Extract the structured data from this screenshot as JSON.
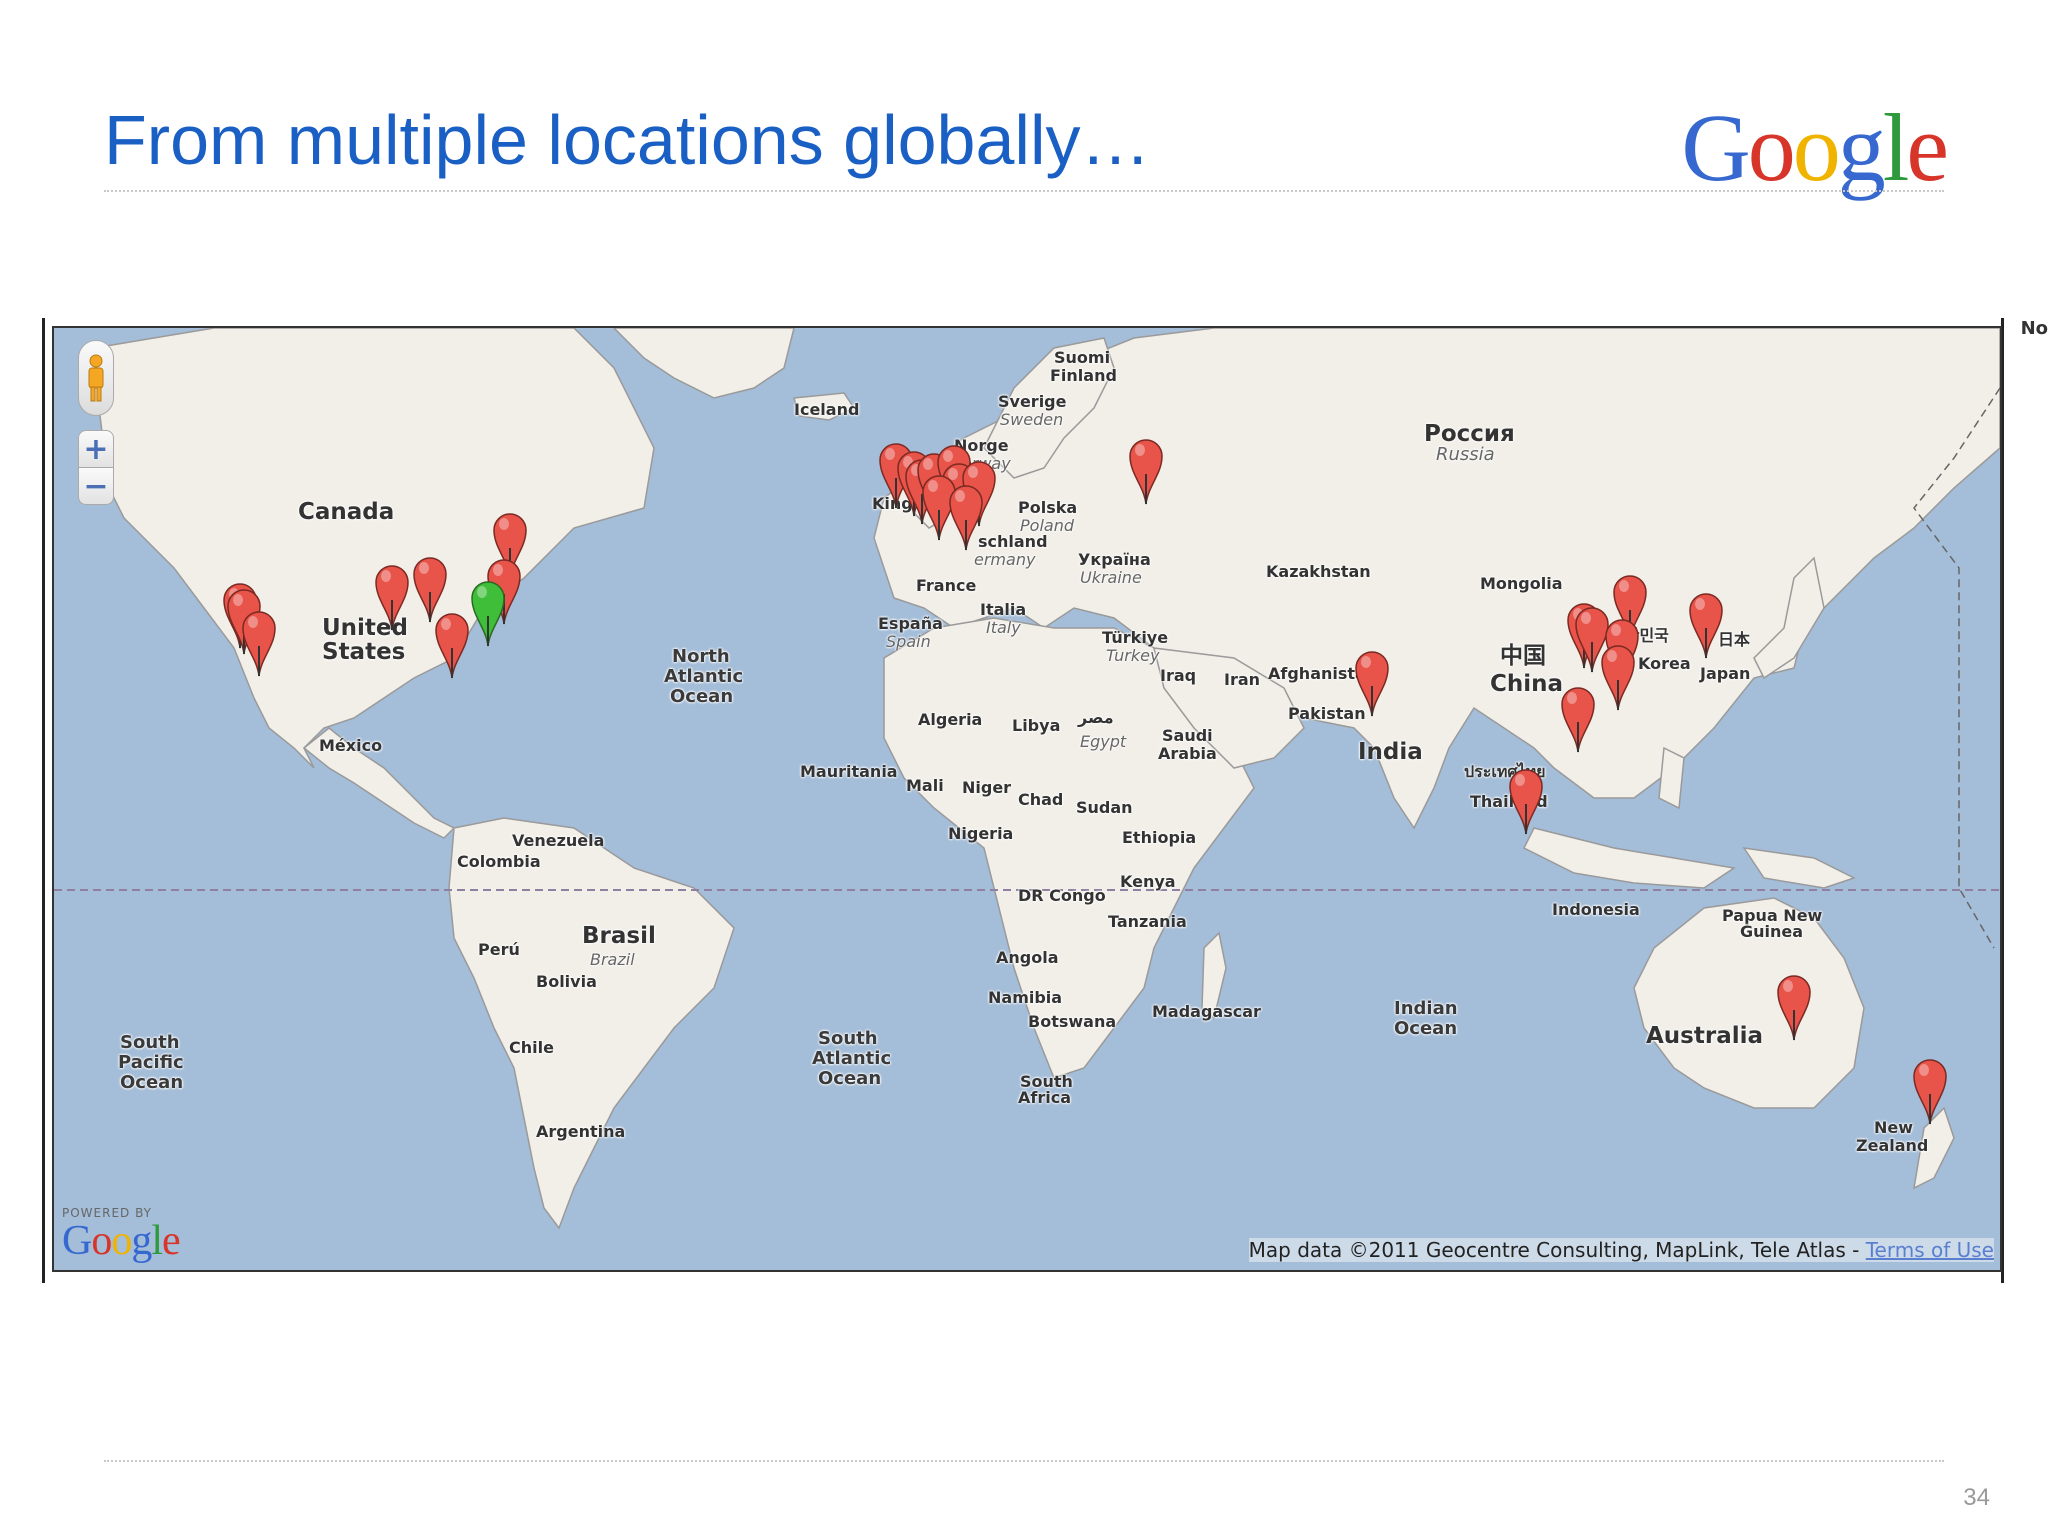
{
  "slide": {
    "title": "From multiple locations globally…",
    "page_number": "34",
    "logo_letters": [
      {
        "ch": "G",
        "color": "#3668cf"
      },
      {
        "ch": "o",
        "color": "#d8352a"
      },
      {
        "ch": "o",
        "color": "#f0b400"
      },
      {
        "ch": "g",
        "color": "#3668cf"
      },
      {
        "ch": "l",
        "color": "#2f9a3d"
      },
      {
        "ch": "e",
        "color": "#d8352a"
      }
    ]
  },
  "map": {
    "colors": {
      "water": "#a4bdd8",
      "land": "#f2efe9",
      "pin_red": "#e8534a",
      "pin_green": "#3fbe3a"
    },
    "controls": {
      "pegman_icon": "pegman-icon",
      "zoom_in_label": "+",
      "zoom_out_label": "−"
    },
    "powered_by": "POWERED BY",
    "powered_logo": "Google",
    "attribution": "Map data ©2011 Geocentre Consulting, MapLink, Tele Atlas - ",
    "terms_label": "Terms of Use",
    "cut_label": "No",
    "labels": {
      "canada": "Canada",
      "us1": "United",
      "us2": "States",
      "mexico": "México",
      "venezuela": "Venezuela",
      "colombia": "Colombia",
      "peru": "Perú",
      "brasil": "Brasil",
      "brazil": "Brazil",
      "bolivia": "Bolivia",
      "chile": "Chile",
      "argentina": "Argentina",
      "iceland": "Iceland",
      "suomi": "Suomi",
      "finland": "Finland",
      "sverige": "Sverige",
      "sweden": "Sweden",
      "norge": "Norge",
      "norway": "Norway",
      "polska": "Polska",
      "poland": "Poland",
      "deutschland": "schland",
      "germany": "ermany",
      "ukraina": "Україна",
      "ukraine": "Ukraine",
      "france": "France",
      "espana": "España",
      "spain": "Spain",
      "italia": "Italia",
      "italy": "Italy",
      "turkiye": "Türkiye",
      "turkey": "Turkey",
      "uk": "King",
      "russia_native": "Россия",
      "russia": "Russia",
      "kazakhstan": "Kazakhstan",
      "mongolia": "Mongolia",
      "china_native": "中国",
      "china": "China",
      "korea_native": "대한민국",
      "korea": "Korea",
      "japan_native": "日本",
      "japan": "Japan",
      "iraq": "Iraq",
      "iran": "Iran",
      "afghanistan": "Afghanista",
      "pakistan": "Pakistan",
      "india": "India",
      "thailand_native": "ประเทศไทย",
      "thailand": "Thailand",
      "indonesia": "Indonesia",
      "png1": "Papua New",
      "png2": "Guinea",
      "australia": "Australia",
      "nz1": "New",
      "nz2": "Zealand",
      "algeria": "Algeria",
      "libya": "Libya",
      "egypt_native": "مصر",
      "egypt": "Egypt",
      "saudi1": "Saudi",
      "saudi2": "Arabia",
      "mauritania": "Mauritania",
      "mali": "Mali",
      "niger": "Niger",
      "chad": "Chad",
      "sudan": "Sudan",
      "nigeria": "Nigeria",
      "ethiopia": "Ethiopia",
      "kenya": "Kenya",
      "drcongo": "DR Congo",
      "tanzania": "Tanzania",
      "angola": "Angola",
      "namibia": "Namibia",
      "botswana": "Botswana",
      "madagascar": "Madagascar",
      "sa1": "South",
      "sa2": "Africa",
      "nao1": "North",
      "nao2": "Atlantic",
      "nao3": "Ocean",
      "sao1": "South",
      "sao2": "Atlantic",
      "sao3": "Ocean",
      "spo1": "South",
      "spo2": "Pacific",
      "spo3": "Ocean",
      "io1": "Indian",
      "io2": "Ocean"
    },
    "markers": {
      "pin_icon": "map-pin-icon",
      "red_count": 33,
      "green_count": 1
    }
  }
}
